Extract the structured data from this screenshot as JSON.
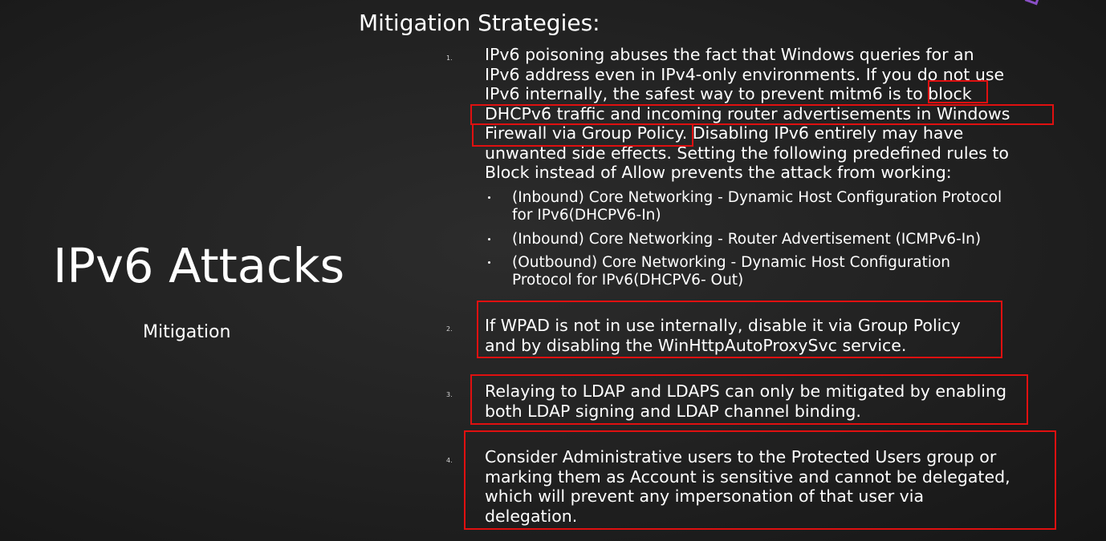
{
  "slide": {
    "title": "IPv6 Attacks",
    "subtitle": "Mitigation",
    "heading": "Mitigation Strategies:"
  },
  "items": [
    {
      "number": "1.",
      "lines": [
        "IPv6 poisoning abuses the fact that Windows queries for an",
        "IPv6 address even in IPv4-only environments. If you do not use",
        "IPv6 internally, the safest way to prevent mitm6 is to block",
        "DHCPv6 traffic and incoming router advertisements in Windows",
        "Firewall via Group Policy. Disabling IPv6 entirely may have",
        "unwanted side effects. Setting the following predefined rules to",
        "Block instead of Allow prevents the attack from working:"
      ],
      "sub_items": [
        {
          "lines": [
            "(Inbound) Core Networking - Dynamic Host Configuration Protocol",
            "for IPv6(DHCPV6-In)"
          ]
        },
        {
          "lines": [
            "(Inbound) Core Networking - Router Advertisement (ICMPv6-In)"
          ]
        },
        {
          "lines": [
            "(Outbound) Core Networking - Dynamic Host Configuration",
            "Protocol for IPv6(DHCPV6- Out)"
          ]
        }
      ]
    },
    {
      "number": "2.",
      "lines": [
        "If WPAD is not in use internally, disable it via Group Policy",
        "and by disabling the WinHttpAutoProxySvc service."
      ]
    },
    {
      "number": "3.",
      "lines": [
        "Relaying to LDAP and LDAPS can only be mitigated by enabling",
        "both LDAP signing and LDAP channel binding."
      ]
    },
    {
      "number": "4.",
      "lines": [
        "Consider Administrative users to the Protected Users group or",
        "marking them as Account is sensitive and cannot be delegated,",
        "which will prevent any impersonation of that user via",
        "delegation."
      ]
    }
  ],
  "colors": {
    "background": "#1e1e1e",
    "text": "#ffffff",
    "highlight_box": "#e01010",
    "corner_accent": "#8a4fc7"
  }
}
